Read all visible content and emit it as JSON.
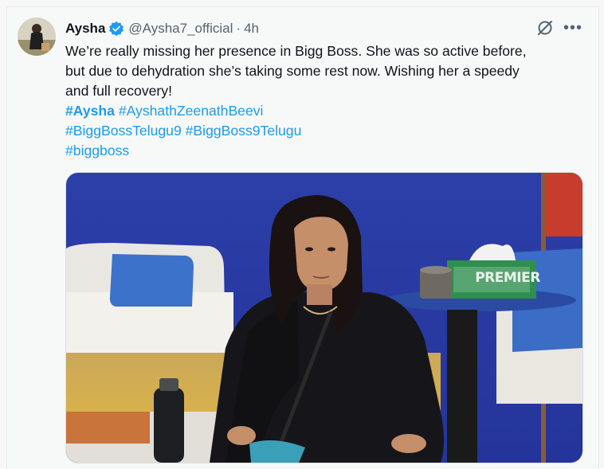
{
  "tweet": {
    "author_name": "Aysha",
    "handle": "@Aysha7_official",
    "separator": "·",
    "time": "4h",
    "text_lines": [
      "We’re really missing her presence in Bigg Boss. She was so active before,",
      "but due to dehydration she’s taking some rest now. Wishing her a speedy",
      "and full recovery!"
    ],
    "hashtags": {
      "line1": [
        "#Aysha",
        "#AyshathZeenathBeevi"
      ],
      "line2": [
        "#BiggBossTelugu9",
        "#BiggBoss9Telugu"
      ],
      "line3": [
        "#biggboss"
      ]
    },
    "more_glyph": "•••",
    "media": {
      "sign_text": "PREMIER"
    }
  },
  "colors": {
    "accent": "#1d9bf0",
    "text": "#0f1419",
    "muted": "#536471"
  },
  "icons": [
    "verified-badge-icon",
    "grok-icon",
    "more-options-icon"
  ]
}
